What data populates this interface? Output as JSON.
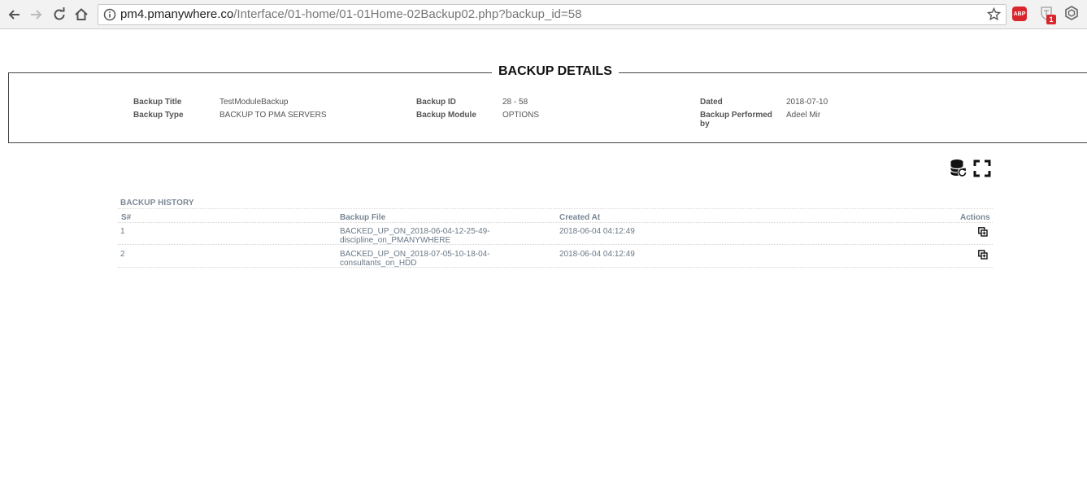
{
  "browser": {
    "url_host": "pm4.pmanywhere.co",
    "url_path": "/Interface/01-home/01-01Home-02Backup02.php?backup_id=58",
    "abp_label": "ABP",
    "ext_badge": "1"
  },
  "details": {
    "title": "BACKUP DETAILS",
    "fields": [
      {
        "label": "Backup Title",
        "value": "TestModuleBackup"
      },
      {
        "label": "Backup Type",
        "value": "BACKUP TO PMA SERVERS"
      },
      {
        "label": "Backup ID",
        "value": "28 - 58"
      },
      {
        "label": "Backup Module",
        "value": "OPTIONS"
      },
      {
        "label": "Dated",
        "value": "2018-07-10"
      },
      {
        "label": "Backup Performed by",
        "value": "Adeel Mir"
      }
    ]
  },
  "history": {
    "title": "BACKUP HISTORY",
    "columns": [
      "S#",
      "Backup File",
      "Created At",
      "Actions"
    ],
    "rows": [
      {
        "sn": "1",
        "file_line1": "BACKED_UP_ON_2018-06-04-12-25-49-",
        "file_line2": "discipline_on_PMANYWHERE",
        "created": "2018-06-04 04:12:49"
      },
      {
        "sn": "2",
        "file_line1": "BACKED_UP_ON_2018-07-05-10-18-04-",
        "file_line2": "consultants_on_HDD",
        "created": "2018-06-04 04:12:49"
      }
    ]
  },
  "icons": {
    "back": "back-arrow-icon",
    "forward": "forward-arrow-icon",
    "reload": "reload-icon",
    "home": "home-icon",
    "info": "info-icon",
    "star": "star-icon",
    "restore": "database-restore-icon",
    "fullscreen": "fullscreen-icon",
    "copy": "copy-icon"
  }
}
